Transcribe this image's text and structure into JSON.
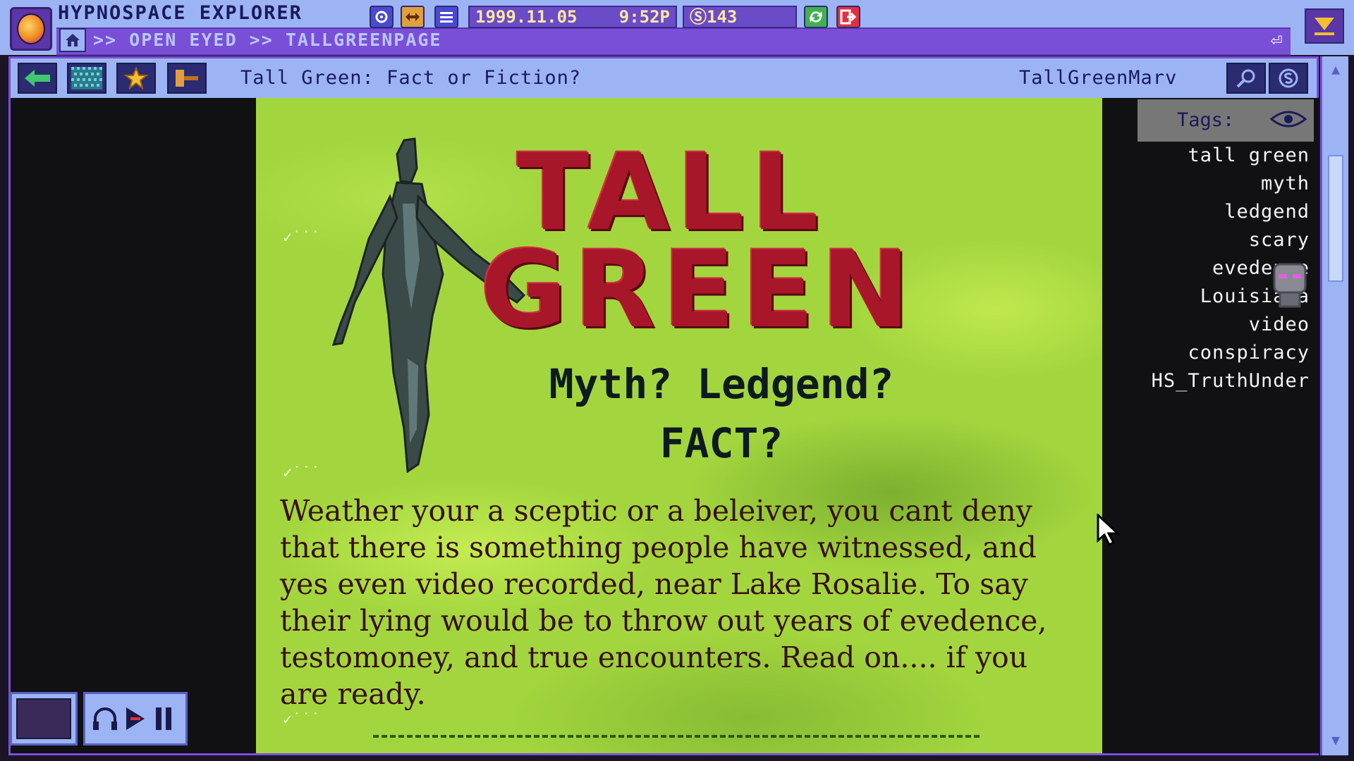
{
  "app": {
    "title": "HYPNOSPACE EXPLORER",
    "date": "1999.11.05",
    "time": "9:52P",
    "coins": "Ⓢ143",
    "address": ">> OPEN EYED >> TALLGREENPAGE"
  },
  "page": {
    "title": "Tall Green: Fact or Fiction?",
    "author": "TallGreenMarv"
  },
  "content": {
    "headline_1": "TALL",
    "headline_2": "GREEN",
    "subhead_1": "Myth? Ledgend?",
    "subhead_2": "FACT?",
    "body": "Weather your a sceptic or a beleiver, you cant deny that there is something people have witnessed, and yes even video recorded, near Lake Rosalie. To say their lying would be to throw out years of evedence, testomoney, and true encounters. Read on.... if you are ready."
  },
  "tags": {
    "label": "Tags:",
    "items": [
      "tall green",
      "myth",
      "ledgend",
      "scary",
      "evedence",
      "Louisiana",
      "video",
      "conspiracy",
      "HS_TruthUnder"
    ]
  },
  "colors": {
    "frame": "#9cb4f4",
    "accent": "#7a4fd8",
    "headline": "#a8162a",
    "page_bg": "#a3d63e"
  },
  "icons": [
    "app-logo-icon",
    "settings-icon",
    "resize-icon",
    "menu-icon",
    "refresh-icon",
    "exit-icon",
    "home-icon",
    "return-arrow-icon",
    "minimize-icon",
    "back-arrow-icon",
    "pattern-icon",
    "star-icon",
    "hammer-icon",
    "search-icon",
    "coin-icon",
    "eye-icon",
    "headphones-icon",
    "play-icon",
    "pause-icon"
  ]
}
